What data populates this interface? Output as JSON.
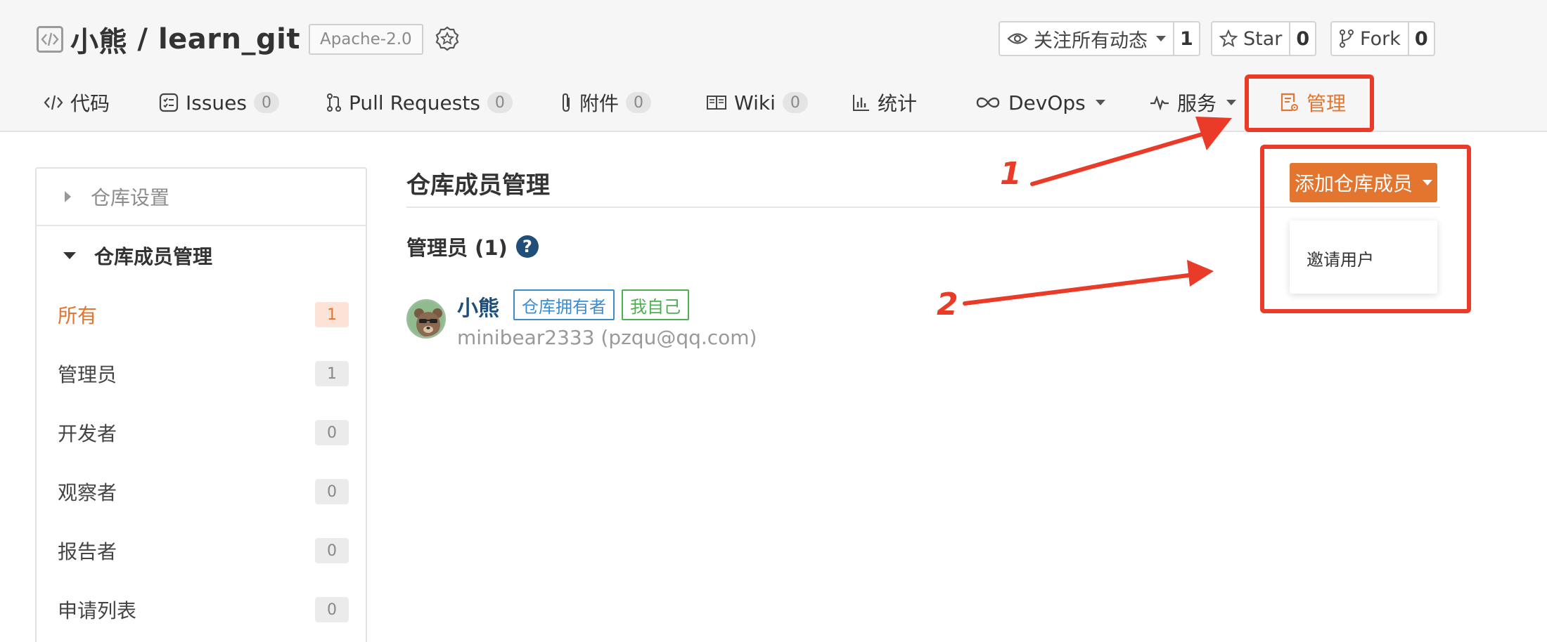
{
  "repo": {
    "owner": "小熊",
    "separator": " / ",
    "name": "learn_git",
    "license": "Apache-2.0"
  },
  "actions": {
    "watch": {
      "label": "关注所有动态",
      "count": "1",
      "icon": "eye-icon"
    },
    "star": {
      "label": "Star",
      "count": "0",
      "icon": "star-icon"
    },
    "fork": {
      "label": "Fork",
      "count": "0",
      "icon": "fork-icon"
    }
  },
  "tabs": [
    {
      "label": "代码",
      "icon": "code-icon"
    },
    {
      "label": "Issues",
      "count": "0",
      "icon": "issues-icon"
    },
    {
      "label": "Pull Requests",
      "count": "0",
      "icon": "pull-request-icon"
    },
    {
      "label": "附件",
      "count": "0",
      "icon": "paperclip-icon"
    },
    {
      "label": "Wiki",
      "count": "0",
      "icon": "book-icon"
    },
    {
      "label": "统计",
      "icon": "bar-chart-icon"
    },
    {
      "label": "DevOps",
      "icon": "infinity-icon",
      "dropdown": true
    },
    {
      "label": "服务",
      "icon": "pulse-icon",
      "dropdown": true
    },
    {
      "label": "管理",
      "icon": "settings-doc-icon",
      "active": true
    }
  ],
  "sidebar": {
    "settings_label": "仓库设置",
    "members_label": "仓库成员管理",
    "items": [
      {
        "label": "所有",
        "count": "1",
        "active": true
      },
      {
        "label": "管理员",
        "count": "1"
      },
      {
        "label": "开发者",
        "count": "0"
      },
      {
        "label": "观察者",
        "count": "0"
      },
      {
        "label": "报告者",
        "count": "0"
      },
      {
        "label": "申请列表",
        "count": "0"
      }
    ]
  },
  "main": {
    "title": "仓库成员管理",
    "admin_heading": "管理员 (1)",
    "help_glyph": "?",
    "add_button": "添加仓库成员",
    "dropdown_item": "邀请用户",
    "member": {
      "name": "小熊",
      "tag_owner": "仓库拥有者",
      "tag_self": "我自己",
      "detail": "minibear2333 (pzqu@qq.com)"
    }
  },
  "annotations": {
    "one": "1",
    "two": "2"
  },
  "colors": {
    "accent": "#e4752e",
    "annotation_red": "#ea3b28",
    "link_blue": "#1f4e79",
    "owner_blue": "#3b8bd3",
    "self_green": "#4caf50"
  }
}
